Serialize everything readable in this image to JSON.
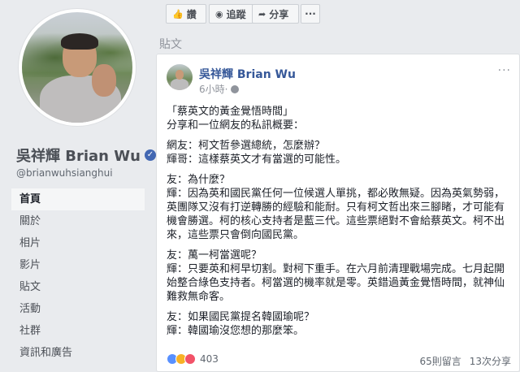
{
  "profile": {
    "name": "吳祥輝 Brian Wu",
    "handle": "@brianwuhsianghui"
  },
  "nav": {
    "items": [
      "首頁",
      "關於",
      "相片",
      "影片",
      "貼文",
      "活動",
      "社群",
      "資訊和廣告"
    ],
    "active_index": 0
  },
  "actions": {
    "like_label": "讚",
    "follow_label": "追蹤",
    "share_label": "分享",
    "more_label": "···"
  },
  "section_title": "貼文",
  "post": {
    "author": "吳祥輝 Brian Wu",
    "time": "6小時",
    "lines": [
      "「蔡英文的黃金覺悟時間」",
      "分享和一位網友的私訊概要：",
      "",
      "網友：柯文哲參選總統，怎麼辦？",
      "輝哥：這樣蔡英文才有當選的可能性。",
      "",
      "友：為什麼？",
      "輝：因為英和國民黨任何一位候選人單挑，都必敗無疑。因為英氣勢弱，英團隊又沒有打逆轉勝的經驗和能耐。只有柯文哲出來三腳睹，才可能有機會勝選。柯的核心支持者是藍三代。這些票絕對不會給蔡英文。柯不出來，這些票只會倒向國民黨。",
      "",
      "友：萬一柯當選呢？",
      "輝：只要英和柯早切割。對柯下重手。在六月前清理戰場完成。七月起開始整合綠色支持者。柯當選的機率就是零。英錯過黃金覺悟時間，就神仙難救無命客。",
      "",
      "友：如果國民黨提名韓國瑜呢？",
      "輝：韓國瑜沒您想的那麼笨。"
    ],
    "reactions_count": "403",
    "comments": "65則留言",
    "shares": "13次分享"
  }
}
